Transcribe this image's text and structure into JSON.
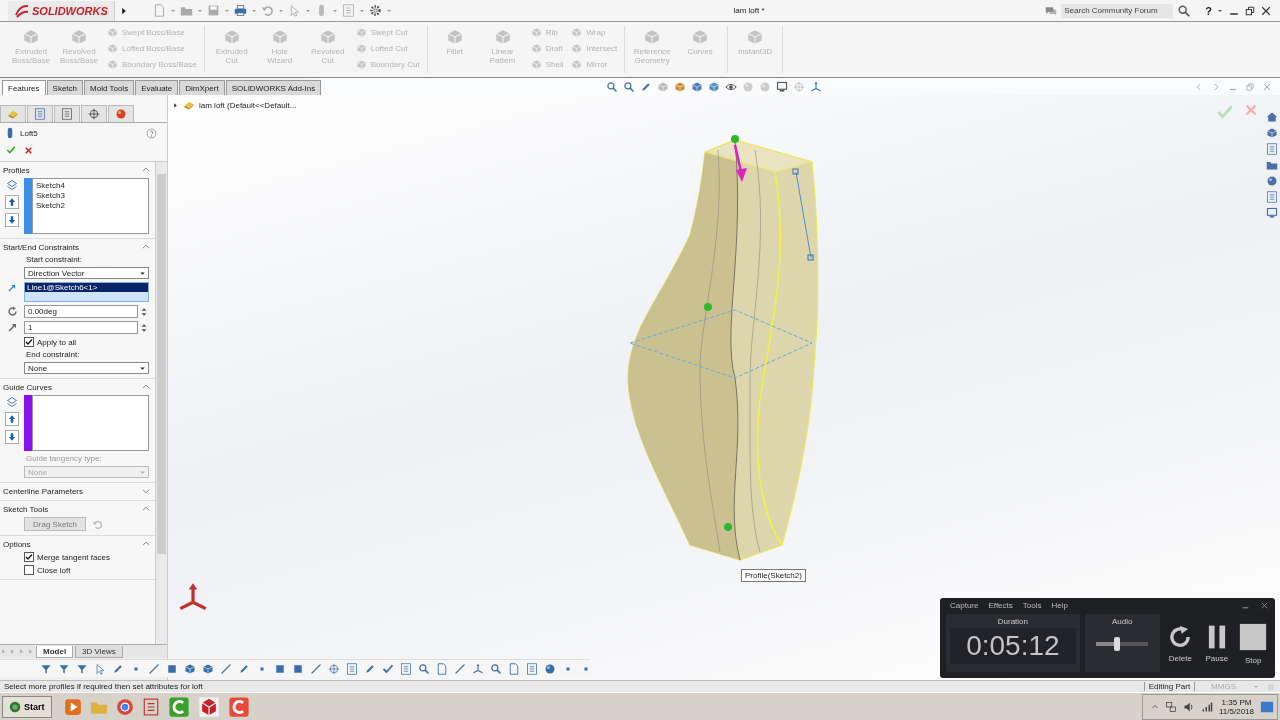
{
  "app": {
    "logo": "SOLIDWORKS",
    "title": "lam loft *",
    "search": {
      "placeholder": "Search Community Forum"
    },
    "help": "?"
  },
  "ribbon": {
    "disabled": true,
    "groups": [
      {
        "columns": [
          {
            "kind": "large",
            "label": "Extruded Boss/Base"
          },
          {
            "kind": "large",
            "label": "Revolved Boss/Base"
          },
          {
            "kind": "stack",
            "items": [
              "Swept Boss/Base",
              "Lofted Boss/Base",
              "Boundary Boss/Base"
            ]
          }
        ]
      },
      {
        "columns": [
          {
            "kind": "large",
            "label": "Extruded Cut"
          },
          {
            "kind": "large",
            "label": "Hole Wizard"
          },
          {
            "kind": "large",
            "label": "Revolved Cut"
          },
          {
            "kind": "stack",
            "items": [
              "Swept Cut",
              "Lofted Cut",
              "Boundary Cut"
            ]
          }
        ]
      },
      {
        "columns": [
          {
            "kind": "large",
            "label": "Fillet"
          },
          {
            "kind": "large",
            "label": "Linear Pattern"
          },
          {
            "kind": "stack",
            "items": [
              "Rib",
              "Draft",
              "Shell"
            ]
          },
          {
            "kind": "stack",
            "items": [
              "Wrap",
              "Intersect",
              "Mirror"
            ]
          }
        ]
      },
      {
        "columns": [
          {
            "kind": "large",
            "label": "Reference Geometry"
          },
          {
            "kind": "large",
            "label": "Curves"
          }
        ]
      },
      {
        "columns": [
          {
            "kind": "large",
            "label": "Instant3D"
          }
        ]
      }
    ]
  },
  "command_tabs": [
    {
      "label": "Features",
      "selected": true
    },
    {
      "label": "Sketch",
      "selected": false
    },
    {
      "label": "Mold Tools",
      "selected": false
    },
    {
      "label": "Evaluate",
      "selected": false
    },
    {
      "label": "DimXpert",
      "selected": false
    },
    {
      "label": "SOLIDWORKS Add-Ins",
      "selected": false
    }
  ],
  "feature_tree": {
    "root": "lam loft (Default<<Default..."
  },
  "property_manager": {
    "title": "Loft5",
    "sections": [
      {
        "title": "Profiles",
        "expanded": true,
        "rows": [
          {
            "kind": "selection-list",
            "items": [
              "Sketch4",
              "Sketch3",
              "Sketch2"
            ],
            "color": "#3c8fe6"
          }
        ]
      },
      {
        "title": "Start/End Constraints",
        "expanded": true,
        "rows": [
          {
            "kind": "label",
            "text": "Start constraint:",
            "disabled": false
          },
          {
            "kind": "dropdown",
            "value": "Direction Vector",
            "disabled": false
          },
          {
            "kind": "selection-field",
            "value": "Line1@Sketch6<1>"
          },
          {
            "kind": "spinner",
            "value": "0.00deg"
          },
          {
            "kind": "spinner",
            "value": "1"
          },
          {
            "kind": "checkbox",
            "label": "Apply to all",
            "checked": true
          },
          {
            "kind": "label",
            "text": "End constraint:",
            "disabled": false
          },
          {
            "kind": "dropdown",
            "value": "None",
            "disabled": false
          }
        ]
      },
      {
        "title": "Guide Curves",
        "expanded": true,
        "rows": [
          {
            "kind": "selection-list",
            "color": "#8a10f0"
          },
          {
            "kind": "label",
            "text": "Guide tangency type:",
            "disabled": true
          },
          {
            "kind": "dropdown",
            "value": "None",
            "disabled": true
          }
        ]
      },
      {
        "title": "Centerline Parameters",
        "expanded": false
      },
      {
        "title": "Sketch Tools",
        "expanded": true,
        "rows": [
          {
            "kind": "button",
            "label": "Drag Sketch",
            "disabled": true
          }
        ]
      },
      {
        "title": "Options",
        "expanded": true,
        "rows": [
          {
            "kind": "checkbox",
            "label": "Merge tangent faces",
            "checked": true
          },
          {
            "kind": "checkbox",
            "label": "Close loft",
            "checked": false
          }
        ]
      }
    ]
  },
  "graphics": {
    "callout": "Profile(Sketch2)"
  },
  "bottom_tabs": [
    {
      "label": "Model",
      "selected": true
    },
    {
      "label": "3D Views",
      "selected": false
    }
  ],
  "status_bar": {
    "message": "Select more profiles if required then set attributes for loft",
    "mode": "Editing Part",
    "units": "MMGS"
  },
  "recorder": {
    "menu": [
      "Capture",
      "Effects",
      "Tools",
      "Help"
    ],
    "duration_label": "Duration",
    "duration": "0:05:12",
    "audio_label": "Audio",
    "audio": {
      "level": 0.4
    },
    "buttons": [
      {
        "kind": "delete",
        "label": "Delete"
      },
      {
        "kind": "pause",
        "label": "Pause"
      },
      {
        "kind": "stop",
        "label": "Stop"
      }
    ]
  },
  "taskbar": {
    "start": "Start",
    "time": "1:35 PM",
    "date": "11/5/2018"
  }
}
